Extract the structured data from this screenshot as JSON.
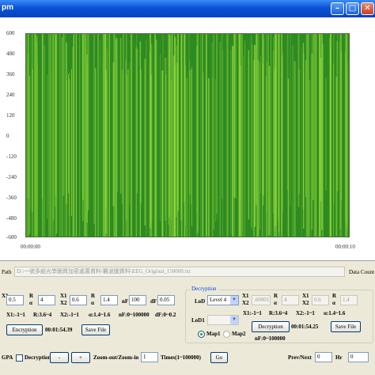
{
  "window": {
    "title": "pm",
    "minimize_glyph": "–",
    "maximize_glyph": "□",
    "close_glyph": "✕"
  },
  "chart_data": {
    "type": "area",
    "y_ticks": [
      "600",
      "480",
      "360",
      "240",
      "120",
      "0",
      "-120",
      "-240",
      "-360",
      "-480",
      "-600"
    ],
    "ylim": [
      -600,
      600
    ],
    "x_ticks": [
      "00:00:00",
      "00:00:10"
    ],
    "series_color": "#2e8b22",
    "highlight_color": "#8fd43a",
    "background_color": "#ffffff",
    "description_values": {
      "amplitude": 600
    }
  },
  "file": {
    "label": "Path",
    "path_value": "D:\\一號多組光學圖資加密處置資料\\醫波圖資料\\EEG_Original_150000.txt",
    "data_count_label": "Data Count"
  },
  "encryption": {
    "x1_value": "0.5",
    "r1_label": "R",
    "r1_sub": "α",
    "r1_value": "4",
    "x1_label": "X1",
    "x2_label": "X2",
    "x2_value": "0.6",
    "r2_value": "1.4",
    "nf_label": "nF",
    "nf_value": "100",
    "df_label": "dF",
    "df_value": "0.05",
    "hint1": "X1:-1~1",
    "hint2": "R:3.6~4",
    "hint3": "X2:-1~1",
    "hint4": "α:1.4~1.6",
    "hint5": "nF:0~100000",
    "hint6": "dF:0~0.2",
    "encrypt_button": "Encryption",
    "encrypt_time": "00:01:54.39",
    "save_button": "Save File"
  },
  "decryption": {
    "group_title": "Decryption",
    "lod_label": "LoD",
    "lod_value": "Level 4",
    "x1_label": "X1",
    "x2_label": "X2",
    "x1_value": ".60001",
    "r_label": "R",
    "r_sub": "α",
    "r_value": "4",
    "x2_value": "0.6",
    "a_value": "1.4",
    "lod1_label": "LoD1",
    "hint1": "X1:-1~1",
    "hint2": "R:3.6~4",
    "hint3": "X2:-1~1",
    "hint4": "α:1.4~1.6",
    "hint5": "nF:0~100000",
    "map1_label": "Map1",
    "map2_label": "Map2",
    "decrypt_button": "Decryption",
    "decrypt_time": "00:01:54.25",
    "save_button": "Save File"
  },
  "bottom": {
    "open_label": "GPA",
    "decryption_check_label": "Decryption",
    "minus_button": "-",
    "plus_button": "+",
    "zoom_label": "Zoom-out/Zoom-in",
    "times_value": "1",
    "times_label": "Times(1~100000)",
    "go_button": "Go",
    "prev_next_label": "Prev/Next",
    "hr_value": "0",
    "hr_label": "Hr",
    "min_value": "0"
  }
}
